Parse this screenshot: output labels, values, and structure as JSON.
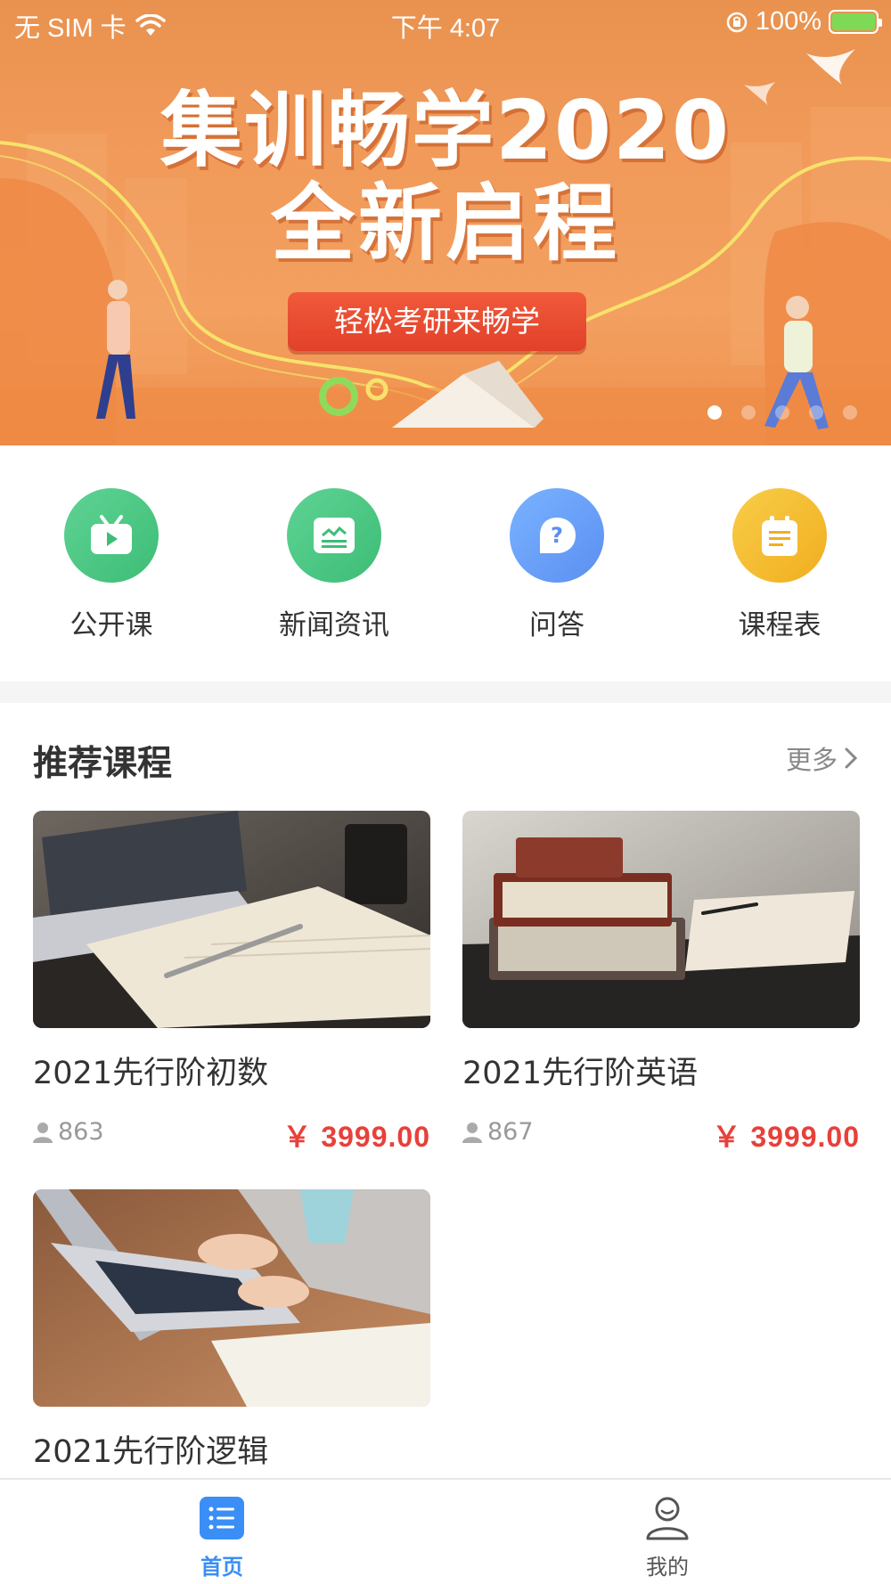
{
  "status_bar": {
    "carrier": "无 SIM 卡",
    "time": "下午 4:07",
    "battery_percent": "100%",
    "battery_level": 1.0
  },
  "banner": {
    "title_line1": "集训畅学2020",
    "title_line2": "全新启程",
    "button_label": "轻松考研来畅学",
    "active_slide": 1,
    "slide_count": 5
  },
  "quick_nav": [
    {
      "label": "公开课",
      "icon": "tv-icon",
      "color": "#3dbd76"
    },
    {
      "label": "新闻资讯",
      "icon": "news-icon",
      "color": "#3dbd76"
    },
    {
      "label": "问答",
      "icon": "question-icon",
      "color": "#5b8ff2"
    },
    {
      "label": "课程表",
      "icon": "schedule-icon",
      "color": "#f1ae1f"
    }
  ],
  "recommended": {
    "title": "推荐课程",
    "more_label": "更多",
    "courses": [
      {
        "name": "2021先行阶初数",
        "students": "863",
        "price": "￥ 3999.00",
        "image": "laptop-notebook-photo"
      },
      {
        "name": "2021先行阶英语",
        "students": "867",
        "price": "￥ 3999.00",
        "image": "books-stack-photo"
      },
      {
        "name": "2021先行阶逻辑",
        "image": "typing-laptop-photo"
      }
    ]
  },
  "tabbar": {
    "home_label": "首页",
    "mine_label": "我的",
    "active": "home"
  },
  "colors": {
    "accent": "#3a8ef6",
    "price": "#e8403a",
    "banner": "#f19a5a"
  }
}
